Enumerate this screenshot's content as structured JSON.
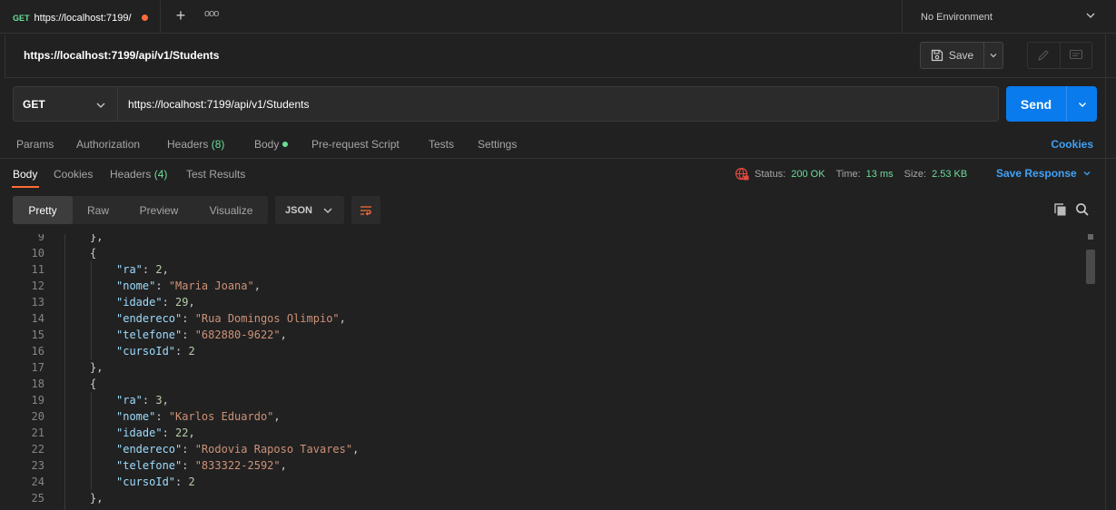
{
  "tab": {
    "method": "GET",
    "title": "https://localhost:7199/"
  },
  "environment": {
    "label": "No Environment"
  },
  "request": {
    "title": "https://localhost:7199/api/v1/Students",
    "save_label": "Save",
    "method": "GET",
    "url": "https://localhost:7199/api/v1/Students",
    "send_label": "Send"
  },
  "request_tabs": {
    "params": "Params",
    "authorization": "Authorization",
    "headers": "Headers",
    "headers_count": "(8)",
    "body": "Body",
    "prerequest": "Pre-request Script",
    "tests": "Tests",
    "settings": "Settings",
    "cookies": "Cookies"
  },
  "response_tabs": {
    "body": "Body",
    "cookies": "Cookies",
    "headers": "Headers",
    "headers_count": "(4)",
    "test_results": "Test Results"
  },
  "status": {
    "status_label": "Status:",
    "status_value": "200 OK",
    "time_label": "Time:",
    "time_value": "13 ms",
    "size_label": "Size:",
    "size_value": "2.53 KB",
    "save_response": "Save Response"
  },
  "view": {
    "modes": [
      "Pretty",
      "Raw",
      "Preview",
      "Visualize"
    ],
    "active_mode": "Pretty",
    "format": "JSON"
  },
  "code_lines": [
    {
      "n": "9",
      "indent": 1,
      "parts": [
        [
          "p",
          "},"
        ]
      ]
    },
    {
      "n": "10",
      "indent": 1,
      "parts": [
        [
          "p",
          "{"
        ]
      ]
    },
    {
      "n": "11",
      "indent": 2,
      "parts": [
        [
          "k",
          "\"ra\""
        ],
        [
          "p",
          ": "
        ],
        [
          "n",
          "2"
        ],
        [
          "p",
          ","
        ]
      ]
    },
    {
      "n": "12",
      "indent": 2,
      "parts": [
        [
          "k",
          "\"nome\""
        ],
        [
          "p",
          ": "
        ],
        [
          "s",
          "\"Maria Joana\""
        ],
        [
          "p",
          ","
        ]
      ]
    },
    {
      "n": "13",
      "indent": 2,
      "parts": [
        [
          "k",
          "\"idade\""
        ],
        [
          "p",
          ": "
        ],
        [
          "n",
          "29"
        ],
        [
          "p",
          ","
        ]
      ]
    },
    {
      "n": "14",
      "indent": 2,
      "parts": [
        [
          "k",
          "\"endereco\""
        ],
        [
          "p",
          ": "
        ],
        [
          "s",
          "\"Rua Domingos Olimpio\""
        ],
        [
          "p",
          ","
        ]
      ]
    },
    {
      "n": "15",
      "indent": 2,
      "parts": [
        [
          "k",
          "\"telefone\""
        ],
        [
          "p",
          ": "
        ],
        [
          "s",
          "\"682880-9622\""
        ],
        [
          "p",
          ","
        ]
      ]
    },
    {
      "n": "16",
      "indent": 2,
      "parts": [
        [
          "k",
          "\"cursoId\""
        ],
        [
          "p",
          ": "
        ],
        [
          "n",
          "2"
        ]
      ]
    },
    {
      "n": "17",
      "indent": 1,
      "parts": [
        [
          "p",
          "},"
        ]
      ]
    },
    {
      "n": "18",
      "indent": 1,
      "parts": [
        [
          "p",
          "{"
        ]
      ]
    },
    {
      "n": "19",
      "indent": 2,
      "parts": [
        [
          "k",
          "\"ra\""
        ],
        [
          "p",
          ": "
        ],
        [
          "n",
          "3"
        ],
        [
          "p",
          ","
        ]
      ]
    },
    {
      "n": "20",
      "indent": 2,
      "parts": [
        [
          "k",
          "\"nome\""
        ],
        [
          "p",
          ": "
        ],
        [
          "s",
          "\"Karlos Eduardo\""
        ],
        [
          "p",
          ","
        ]
      ]
    },
    {
      "n": "21",
      "indent": 2,
      "parts": [
        [
          "k",
          "\"idade\""
        ],
        [
          "p",
          ": "
        ],
        [
          "n",
          "22"
        ],
        [
          "p",
          ","
        ]
      ]
    },
    {
      "n": "22",
      "indent": 2,
      "parts": [
        [
          "k",
          "\"endereco\""
        ],
        [
          "p",
          ": "
        ],
        [
          "s",
          "\"Rodovia Raposo Tavares\""
        ],
        [
          "p",
          ","
        ]
      ]
    },
    {
      "n": "23",
      "indent": 2,
      "parts": [
        [
          "k",
          "\"telefone\""
        ],
        [
          "p",
          ": "
        ],
        [
          "s",
          "\"833322-2592\""
        ],
        [
          "p",
          ","
        ]
      ]
    },
    {
      "n": "24",
      "indent": 2,
      "parts": [
        [
          "k",
          "\"cursoId\""
        ],
        [
          "p",
          ": "
        ],
        [
          "n",
          "2"
        ]
      ]
    },
    {
      "n": "25",
      "indent": 1,
      "parts": [
        [
          "p",
          "},"
        ]
      ]
    }
  ],
  "colors": {
    "accent_orange": "#ff6c37",
    "send_blue": "#097bed",
    "link_blue": "#3fa2f7",
    "success_green": "#6bdd9a"
  }
}
